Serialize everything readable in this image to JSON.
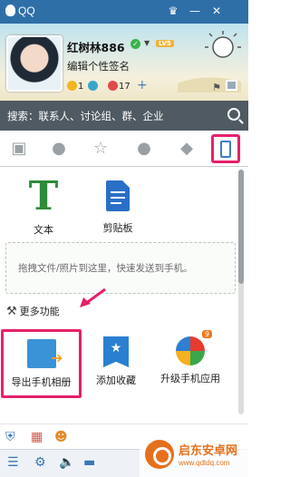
{
  "window": {
    "title": "QQ"
  },
  "profile": {
    "nickname": "红树林886",
    "level_badge": "LV5",
    "signature": "编辑个性签名",
    "stats": [
      {
        "icon": "star-icon",
        "value": "1"
      },
      {
        "icon": "bubble-icon",
        "value": ""
      },
      {
        "icon": "mail-icon",
        "value": "17"
      },
      {
        "icon": "plus-icon",
        "value": "+"
      }
    ]
  },
  "search": {
    "placeholder": "搜索：联系人、讨论组、群、企业"
  },
  "tabs": [
    {
      "name": "messages",
      "active": false
    },
    {
      "name": "contacts",
      "active": false
    },
    {
      "name": "favorites",
      "active": false
    },
    {
      "name": "groups",
      "active": false
    },
    {
      "name": "classroom",
      "active": false
    },
    {
      "name": "phone",
      "active": true
    }
  ],
  "tools": {
    "text": "文本",
    "clipboard": "剪贴板"
  },
  "drop_hint": "拖拽文件/照片到这里，快速发送到手机。",
  "more": {
    "label": "更多功能"
  },
  "apps": [
    {
      "label": "导出手机相册",
      "highlighted": true
    },
    {
      "label": "添加收藏"
    },
    {
      "label": "升级手机应用",
      "badge": "9"
    }
  ],
  "watermark": {
    "title": "启东安卓网",
    "url": "www.qdtdq.com"
  },
  "colors": {
    "accent": "#e6206b",
    "titlebar": "#2f6fa8",
    "search": "#4f5a62"
  }
}
